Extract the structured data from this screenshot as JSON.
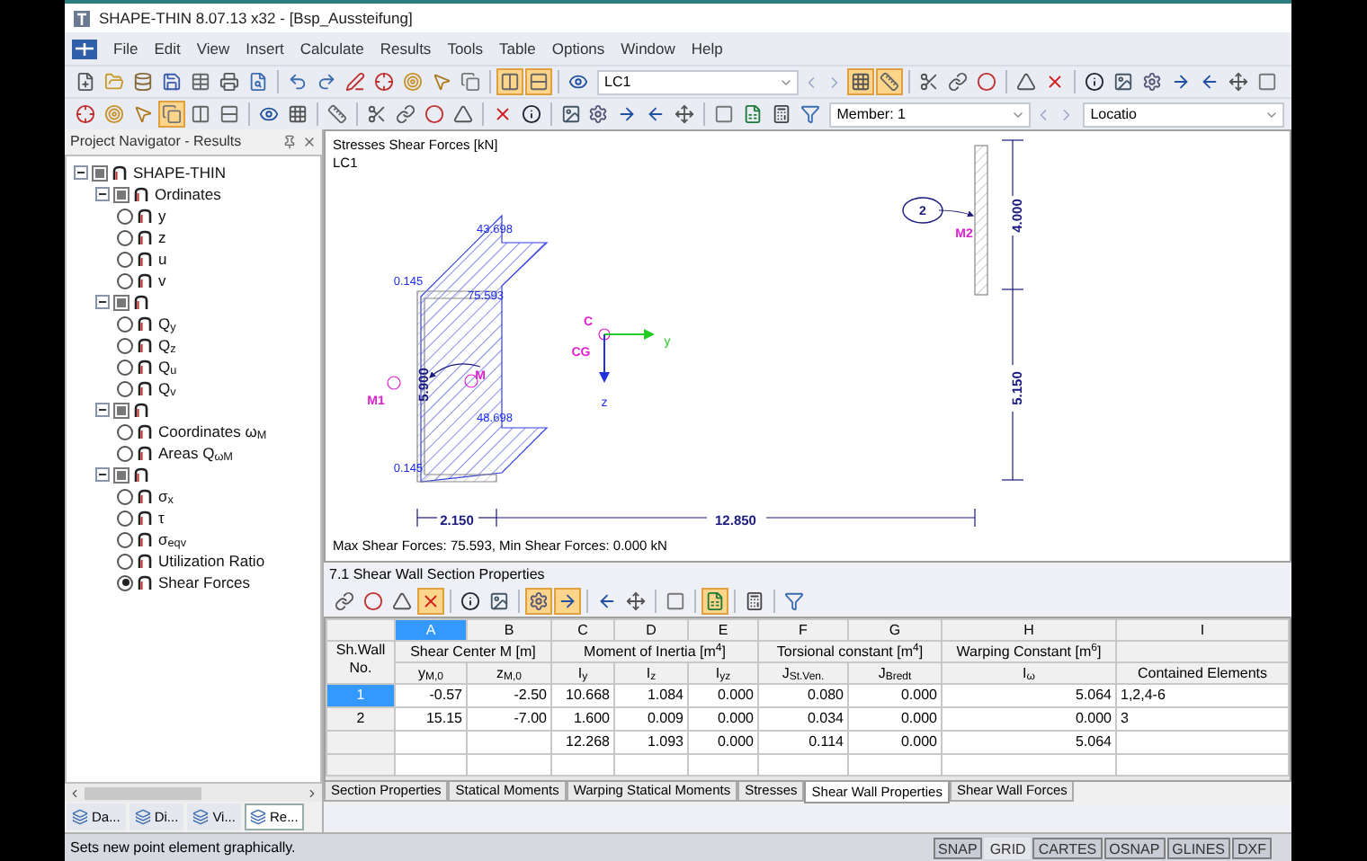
{
  "window": {
    "title": "SHAPE-THIN 8.07.13 x32 - [Bsp_Aussteifung]"
  },
  "menu": [
    "File",
    "Edit",
    "View",
    "Insert",
    "Calculate",
    "Results",
    "Tools",
    "Table",
    "Options",
    "Window",
    "Help"
  ],
  "toolbar_1": [
    {
      "kind": "button",
      "pressed": false
    },
    {
      "kind": "button",
      "pressed": false
    },
    {
      "kind": "button",
      "pressed": false
    },
    {
      "kind": "button",
      "pressed": false
    },
    {
      "kind": "button",
      "pressed": false
    },
    {
      "kind": "button",
      "pressed": false
    },
    {
      "kind": "button",
      "pressed": false
    },
    {
      "kind": "separator"
    },
    {
      "kind": "button",
      "pressed": false
    },
    {
      "kind": "button",
      "pressed": false
    },
    {
      "kind": "button",
      "pressed": false
    },
    {
      "kind": "button",
      "pressed": false
    },
    {
      "kind": "button",
      "pressed": false
    },
    {
      "kind": "button",
      "pressed": false
    },
    {
      "kind": "button",
      "pressed": false
    },
    {
      "kind": "separator"
    },
    {
      "kind": "button",
      "pressed": true
    },
    {
      "kind": "button",
      "pressed": true
    },
    {
      "kind": "separator"
    },
    {
      "kind": "button",
      "pressed": false
    },
    {
      "kind": "combo",
      "value": "LC1"
    },
    {
      "kind": "prev"
    },
    {
      "kind": "next"
    },
    {
      "kind": "button",
      "pressed": true
    },
    {
      "kind": "button",
      "pressed": true
    },
    {
      "kind": "separator"
    },
    {
      "kind": "button",
      "pressed": false
    },
    {
      "kind": "button",
      "pressed": false
    },
    {
      "kind": "button",
      "pressed": false
    },
    {
      "kind": "separator"
    },
    {
      "kind": "button",
      "pressed": false
    },
    {
      "kind": "button",
      "pressed": false
    },
    {
      "kind": "separator"
    },
    {
      "kind": "button",
      "pressed": false
    },
    {
      "kind": "button",
      "pressed": false
    },
    {
      "kind": "button",
      "pressed": false
    },
    {
      "kind": "button",
      "pressed": false
    },
    {
      "kind": "button",
      "pressed": false
    },
    {
      "kind": "button",
      "pressed": false
    },
    {
      "kind": "button",
      "pressed": false
    }
  ],
  "toolbar_2": [
    {
      "kind": "button",
      "pressed": false
    },
    {
      "kind": "button",
      "pressed": false
    },
    {
      "kind": "button",
      "pressed": false
    },
    {
      "kind": "button",
      "pressed": true
    },
    {
      "kind": "button",
      "pressed": false
    },
    {
      "kind": "button",
      "pressed": false
    },
    {
      "kind": "separator"
    },
    {
      "kind": "button",
      "pressed": false
    },
    {
      "kind": "button",
      "pressed": false
    },
    {
      "kind": "separator"
    },
    {
      "kind": "button",
      "pressed": false
    },
    {
      "kind": "separator"
    },
    {
      "kind": "button",
      "pressed": false
    },
    {
      "kind": "button",
      "pressed": false
    },
    {
      "kind": "button",
      "pressed": false
    },
    {
      "kind": "button",
      "pressed": false
    },
    {
      "kind": "separator"
    },
    {
      "kind": "button",
      "pressed": false
    },
    {
      "kind": "button",
      "pressed": false
    },
    {
      "kind": "separator"
    },
    {
      "kind": "button",
      "pressed": false
    },
    {
      "kind": "button",
      "pressed": false
    },
    {
      "kind": "button",
      "pressed": false
    },
    {
      "kind": "button",
      "pressed": false
    },
    {
      "kind": "button",
      "pressed": false
    },
    {
      "kind": "separator"
    },
    {
      "kind": "button",
      "pressed": false
    },
    {
      "kind": "button",
      "pressed": false
    },
    {
      "kind": "button",
      "pressed": false
    },
    {
      "kind": "button",
      "pressed": false
    },
    {
      "kind": "combo",
      "value": "Member: 1"
    },
    {
      "kind": "prev"
    },
    {
      "kind": "next"
    },
    {
      "kind": "combo",
      "value": "Locatio"
    }
  ],
  "navigator": {
    "title": "Project Navigator - Results",
    "tree": [
      {
        "kind": "group",
        "label": "SHAPE-THIN",
        "expanded": true,
        "checked": true,
        "children": [
          {
            "kind": "group",
            "label": "Ordinates",
            "expanded": true,
            "checked": true,
            "children": [
              {
                "kind": "radio",
                "label": "y",
                "selected": false
              },
              {
                "kind": "radio",
                "label": "z",
                "selected": false
              },
              {
                "kind": "radio",
                "label": "u",
                "selected": false
              },
              {
                "kind": "radio",
                "label": "v",
                "selected": false
              }
            ]
          },
          {
            "kind": "group",
            "expanded": true,
            "checked": true,
            "children": [
              {
                "kind": "radio",
                "label": "Q$_{y}$",
                "selected": false
              },
              {
                "kind": "radio",
                "label": "Q$_{z}$",
                "selected": false
              },
              {
                "kind": "radio",
                "label": "Q$_{u}$",
                "selected": false
              },
              {
                "kind": "radio",
                "label": "Q$_{v}$",
                "selected": false
              }
            ]
          },
          {
            "kind": "group",
            "expanded": true,
            "checked": true,
            "children": [
              {
                "kind": "radio",
                "label": "Coordinates ω$_{M}$",
                "selected": false
              },
              {
                "kind": "radio",
                "label": "Areas Q$_{ωM}$",
                "selected": false
              }
            ]
          },
          {
            "kind": "group",
            "expanded": true,
            "checked": true,
            "children": [
              {
                "kind": "radio",
                "label": "σ$_{x}$",
                "selected": false
              },
              {
                "kind": "radio",
                "label": "τ",
                "selected": false
              },
              {
                "kind": "radio",
                "label": "σ$_{eqv}$",
                "selected": false
              },
              {
                "kind": "radio",
                "label": "Utilization Ratio",
                "selected": false
              },
              {
                "kind": "radio",
                "label": "Shear Forces",
                "selected": true
              }
            ]
          }
        ]
      }
    ],
    "tabs": [
      {
        "label": "Da...",
        "selected": false
      },
      {
        "label": "Di...",
        "selected": false
      },
      {
        "label": "Vi...",
        "selected": false
      },
      {
        "label": "Re...",
        "selected": true
      }
    ]
  },
  "drawing": {
    "title": "Stresses Shear Forces [kN]",
    "load_case": "LC1",
    "labels": [
      {
        "kind": "value",
        "text": "43.698"
      },
      {
        "kind": "value",
        "text": "0.145"
      },
      {
        "kind": "value",
        "text": "75.593"
      },
      {
        "kind": "dimension",
        "text": "5.900"
      },
      {
        "kind": "point",
        "text": "M1"
      },
      {
        "kind": "point",
        "text": "M"
      },
      {
        "kind": "value",
        "text": "48.698"
      },
      {
        "kind": "value",
        "text": "0.145"
      },
      {
        "kind": "point",
        "text": "C"
      },
      {
        "kind": "point",
        "text": "CG"
      },
      {
        "kind": "axis",
        "text": "y",
        "color": "#22cc22"
      },
      {
        "kind": "axis",
        "text": "z",
        "color": "#2233dd"
      },
      {
        "kind": "wall",
        "text": "2"
      },
      {
        "kind": "point",
        "text": "M2"
      },
      {
        "kind": "dimension",
        "text": "4.000"
      },
      {
        "kind": "dimension",
        "text": "5.150"
      },
      {
        "kind": "dimension",
        "text": "2.150"
      },
      {
        "kind": "dimension",
        "text": "12.850"
      }
    ],
    "footer": "Max Shear Forces: 75.593, Min Shear Forces: 0.000 kN"
  },
  "table": {
    "title": "7.1 Shear Wall Section Properties",
    "toolbar": [
      {
        "kind": "button",
        "pressed": false
      },
      {
        "kind": "button",
        "pressed": false
      },
      {
        "kind": "button",
        "pressed": false
      },
      {
        "kind": "button",
        "pressed": true
      },
      {
        "kind": "separator"
      },
      {
        "kind": "button",
        "pressed": false
      },
      {
        "kind": "button",
        "pressed": false
      },
      {
        "kind": "separator"
      },
      {
        "kind": "button",
        "pressed": true
      },
      {
        "kind": "button",
        "pressed": true
      },
      {
        "kind": "separator"
      },
      {
        "kind": "button",
        "pressed": false
      },
      {
        "kind": "button",
        "pressed": false
      },
      {
        "kind": "separator"
      },
      {
        "kind": "button",
        "pressed": false
      },
      {
        "kind": "separator"
      },
      {
        "kind": "button",
        "pressed": true
      },
      {
        "kind": "separator"
      },
      {
        "kind": "button",
        "pressed": false
      },
      {
        "kind": "separator"
      },
      {
        "kind": "button",
        "pressed": false
      }
    ],
    "corner": "Sh.Wall No.",
    "columns": [
      {
        "letter": "A",
        "selected": true,
        "group": "Shear Center M [m]",
        "sub": "y$_{M,0}$"
      },
      {
        "letter": "B",
        "selected": false,
        "group_continues": true,
        "sub": "z$_{M,0}$"
      },
      {
        "letter": "C",
        "selected": false,
        "group": "Moment of Inertia [m$^{4}$]",
        "sub": "I$_{y}$"
      },
      {
        "letter": "D",
        "selected": false,
        "group_continues": true,
        "sub": "I$_{z}$"
      },
      {
        "letter": "E",
        "selected": false,
        "group_continues": true,
        "sub": "I$_{yz}$"
      },
      {
        "letter": "F",
        "selected": false,
        "group": "Torsional constant [m$^{4}$]",
        "sub": "J$_{St.Ven.}$"
      },
      {
        "letter": "G",
        "selected": false,
        "group_continues": true,
        "sub": "J$_{Bredt}$"
      },
      {
        "letter": "H",
        "selected": false,
        "group": "Warping Constant [m$^{6}$]",
        "sub": "I$_{ω}$"
      },
      {
        "letter": "I",
        "selected": false,
        "sub": "Contained Elements"
      }
    ],
    "rows": [
      {
        "no": "1",
        "selected": true,
        "cells": {
          "A": "-0.57",
          "B": "-2.50",
          "C": "10.668",
          "D": "1.084",
          "E": "0.000",
          "F": "0.080",
          "G": "0.000",
          "H": "5.064",
          "I": "1,2,4-6"
        }
      },
      {
        "no": "2",
        "selected": false,
        "cells": {
          "A": "15.15",
          "B": "-7.00",
          "C": "1.600",
          "D": "0.009",
          "E": "0.000",
          "F": "0.034",
          "G": "0.000",
          "H": "0.000",
          "I": "3"
        }
      },
      {
        "selected": false,
        "cells": {
          "C": "12.268",
          "D": "1.093",
          "E": "0.000",
          "F": "0.114",
          "G": "0.000",
          "H": "5.064"
        }
      }
    ],
    "sheets": [
      {
        "label": "Section Properties",
        "selected": false
      },
      {
        "label": "Statical Moments",
        "selected": false
      },
      {
        "label": "Warping Statical Moments",
        "selected": false
      },
      {
        "label": "Stresses",
        "selected": false
      },
      {
        "label": "Shear Wall Properties",
        "selected": true
      },
      {
        "label": "Shear Wall Forces",
        "selected": false
      }
    ]
  },
  "status_bar": {
    "text": "Sets new point element graphically.",
    "toggles": [
      {
        "label": "SNAP",
        "on": true
      },
      {
        "label": "GRID",
        "on": false
      },
      {
        "label": "CARTES",
        "on": true
      },
      {
        "label": "OSNAP",
        "on": true
      },
      {
        "label": "GLINES",
        "on": true
      },
      {
        "label": "DXF",
        "on": true
      }
    ]
  }
}
